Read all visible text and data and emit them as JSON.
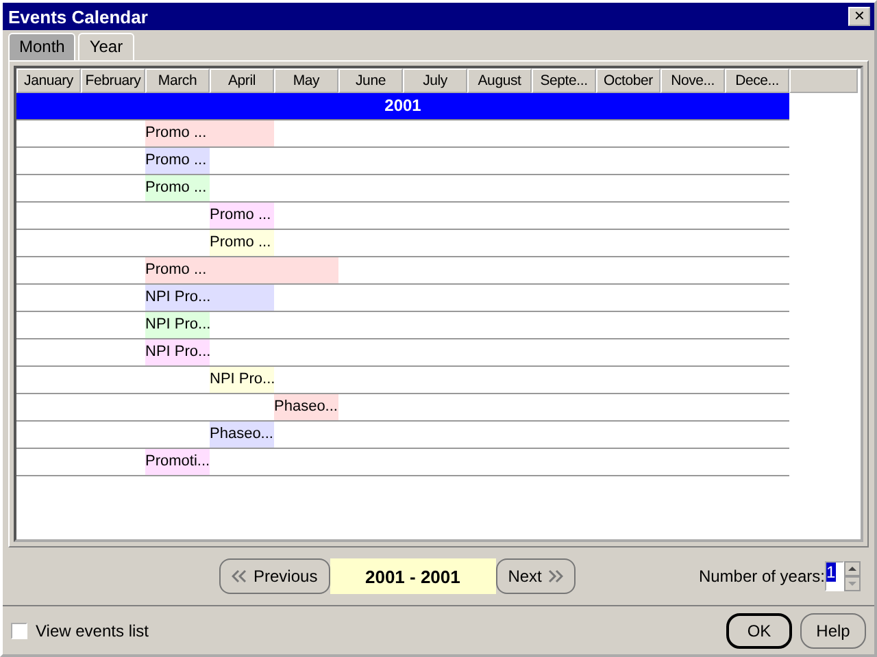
{
  "window": {
    "title": "Events Calendar",
    "close": "✕"
  },
  "tabs": [
    {
      "label": "Month",
      "selected": false
    },
    {
      "label": "Year",
      "selected": true
    }
  ],
  "calendar": {
    "columns": [
      "January",
      "February",
      "March",
      "April",
      "May",
      "June",
      "July",
      "August",
      "Septe...",
      "October",
      "Nove...",
      "Dece..."
    ],
    "year": "2001",
    "events": [
      {
        "label": "Promo ...",
        "color": "#ffdede",
        "months": [
          false,
          false,
          true,
          true,
          false,
          false,
          false,
          false,
          false,
          false,
          false,
          false
        ]
      },
      {
        "label": "Promo ...",
        "color": "#dedeff",
        "months": [
          false,
          false,
          true,
          false,
          false,
          false,
          false,
          false,
          false,
          false,
          false,
          false
        ]
      },
      {
        "label": "Promo ...",
        "color": "#deffde",
        "months": [
          false,
          false,
          true,
          false,
          false,
          false,
          false,
          false,
          false,
          false,
          false,
          false
        ]
      },
      {
        "label": "Promo ...",
        "color": "#ffdeff",
        "months": [
          false,
          false,
          false,
          true,
          false,
          false,
          false,
          false,
          false,
          false,
          false,
          false
        ]
      },
      {
        "label": "Promo ...",
        "color": "#ffffde",
        "months": [
          false,
          false,
          false,
          true,
          false,
          false,
          false,
          false,
          false,
          false,
          false,
          false
        ]
      },
      {
        "label": "Promo ...",
        "color": "#ffdede",
        "months": [
          false,
          false,
          true,
          true,
          true,
          false,
          false,
          false,
          false,
          false,
          false,
          false
        ]
      },
      {
        "label": "NPI Pro...",
        "color": "#dedeff",
        "months": [
          false,
          false,
          true,
          true,
          false,
          false,
          false,
          false,
          false,
          false,
          false,
          false
        ]
      },
      {
        "label": "NPI Pro...",
        "color": "#deffde",
        "months": [
          false,
          false,
          true,
          false,
          false,
          false,
          false,
          false,
          false,
          false,
          false,
          false
        ]
      },
      {
        "label": "NPI Pro...",
        "color": "#ffdeff",
        "months": [
          false,
          false,
          true,
          false,
          false,
          false,
          false,
          false,
          false,
          false,
          false,
          false
        ]
      },
      {
        "label": "NPI Pro...",
        "color": "#ffffde",
        "months": [
          false,
          false,
          false,
          true,
          false,
          false,
          false,
          false,
          false,
          false,
          false,
          false
        ]
      },
      {
        "label": "Phaseo...",
        "color": "#ffdede",
        "months": [
          false,
          false,
          false,
          false,
          true,
          false,
          false,
          false,
          false,
          false,
          false,
          false
        ]
      },
      {
        "label": "Phaseo...",
        "color": "#dedeff",
        "months": [
          false,
          false,
          false,
          true,
          false,
          false,
          false,
          false,
          false,
          false,
          false,
          false
        ]
      },
      {
        "label": "Promoti...",
        "color": "#ffdeff",
        "months": [
          false,
          false,
          true,
          false,
          false,
          false,
          false,
          false,
          false,
          false,
          false,
          false
        ]
      }
    ]
  },
  "navigation": {
    "previous": "Previous",
    "range": "2001 - 2001",
    "next": "Next",
    "years_label": "Number of years:",
    "years_value": "1"
  },
  "view_events_list": {
    "label": "View events list",
    "checked": false
  },
  "buttons": [
    "OK",
    "Help"
  ]
}
